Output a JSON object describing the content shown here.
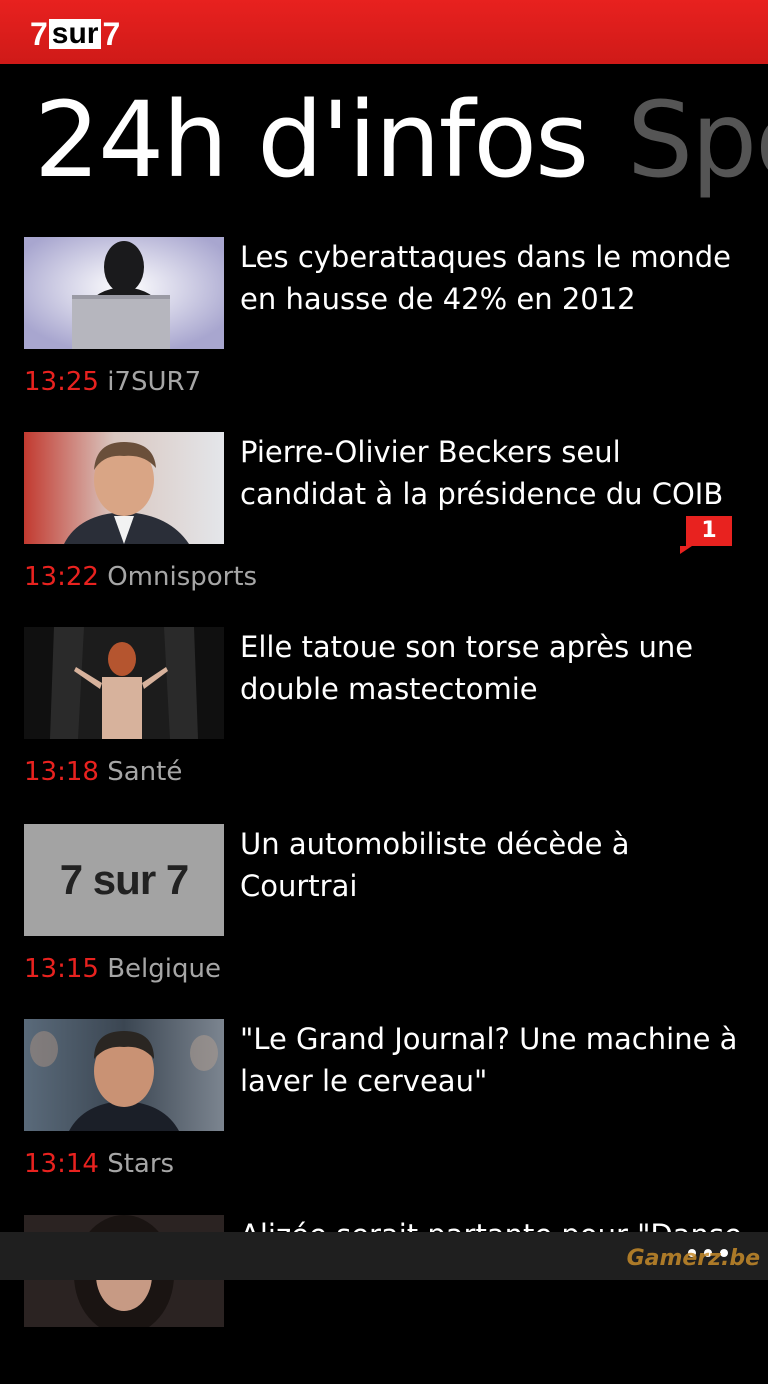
{
  "app": {
    "logo_left": "7",
    "logo_mid": "sur",
    "logo_right": "7"
  },
  "pivot": {
    "active": "24h d'infos",
    "next": "Sport"
  },
  "colors": {
    "accent": "#e8221f",
    "background": "#000000",
    "category": "#a6a6a6"
  },
  "articles": [
    {
      "headline": "Les cyberattaques dans le monde en hausse de 42% en 2012",
      "time": "13:25",
      "category": "i7SUR7",
      "thumbnail": "hacker-laptop"
    },
    {
      "headline": "Pierre-Olivier Beckers seul candidat à la présidence du COIB",
      "time": "13:22",
      "category": "Omnisports",
      "thumbnail": "man-portrait"
    },
    {
      "headline": "Elle tatoue son torse après une double mastectomie",
      "time": "13:18",
      "category": "Santé",
      "thumbnail": "woman-stage",
      "comments": "1"
    },
    {
      "headline": "Un automobiliste décède à Courtrai",
      "time": "13:15",
      "category": "Belgique",
      "thumbnail": "7sur7-placeholder",
      "placeholder_text": "7 sur 7"
    },
    {
      "headline": "\"Le Grand Journal? Une machine à laver le cerveau\"",
      "time": "13:14",
      "category": "Stars",
      "thumbnail": "tv-host-portrait"
    },
    {
      "headline": "Alizée serait partante pour \"Danse",
      "time": "",
      "category": "",
      "thumbnail": "woman-portrait"
    }
  ],
  "watermark": "Gamerz.be"
}
